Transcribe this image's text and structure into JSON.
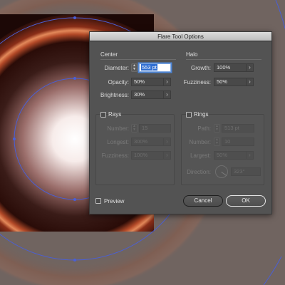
{
  "dialog": {
    "title": "Flare Tool Options",
    "center": {
      "title": "Center",
      "diameter": {
        "label": "Diameter:",
        "value": "553 pt"
      },
      "opacity": {
        "label": "Opacity:",
        "value": "50%"
      },
      "brightness": {
        "label": "Brightness:",
        "value": "30%"
      }
    },
    "halo": {
      "title": "Halo",
      "growth": {
        "label": "Growth:",
        "value": "100%"
      },
      "fuzziness": {
        "label": "Fuzziness:",
        "value": "50%"
      }
    },
    "rays": {
      "title": "Rays",
      "checked": false,
      "number": {
        "label": "Number:",
        "value": "15"
      },
      "longest": {
        "label": "Longest:",
        "value": "300%"
      },
      "fuzziness": {
        "label": "Fuzziness:",
        "value": "100%"
      }
    },
    "rings": {
      "title": "Rings",
      "checked": false,
      "path": {
        "label": "Path:",
        "value": "513 pt"
      },
      "number": {
        "label": "Number:",
        "value": "10"
      },
      "largest": {
        "label": "Largest:",
        "value": "50%"
      },
      "direction": {
        "label": "Direction:",
        "value": "323°"
      }
    },
    "preview": {
      "label": "Preview",
      "checked": false
    },
    "cancel_label": "Cancel",
    "ok_label": "OK",
    "dropdown_caret": "›",
    "stepper_glyph": "▲▼"
  },
  "colors": {
    "canvas_bg": "#706460",
    "flare_core": "#ffffff",
    "flare_ring": "#c2502a",
    "selection": "#4a5fd6",
    "dialog_bg": "#535353"
  }
}
